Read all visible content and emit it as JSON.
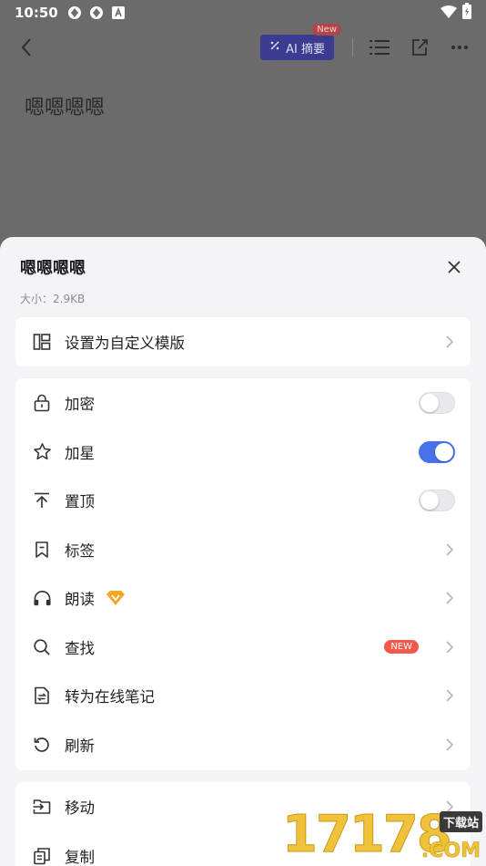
{
  "status_bar": {
    "time": "10:50"
  },
  "toolbar": {
    "ai_label": "AI 摘要",
    "ai_badge": "New"
  },
  "document": {
    "title": "嗯嗯嗯嗯"
  },
  "sheet": {
    "title": "嗯嗯嗯嗯",
    "size_text": "大小：2.9KB",
    "template_item": "设置为自定义模版",
    "items": [
      {
        "label": "加密",
        "icon": "lock-icon",
        "trailing": "toggle",
        "toggle_on": false
      },
      {
        "label": "加星",
        "icon": "star-icon",
        "trailing": "toggle",
        "toggle_on": true
      },
      {
        "label": "置顶",
        "icon": "pin-top-icon",
        "trailing": "toggle",
        "toggle_on": false
      },
      {
        "label": "标签",
        "icon": "bookmark-icon",
        "trailing": "chevron"
      },
      {
        "label": "朗读",
        "icon": "headphones-icon",
        "trailing": "chevron",
        "vip": true
      },
      {
        "label": "查找",
        "icon": "search-icon",
        "trailing": "chevron",
        "badge": "NEW"
      },
      {
        "label": "转为在线笔记",
        "icon": "convert-note-icon",
        "trailing": "chevron"
      },
      {
        "label": "刷新",
        "icon": "refresh-icon",
        "trailing": "chevron"
      }
    ],
    "more_items": [
      {
        "label": "移动",
        "icon": "move-icon"
      },
      {
        "label": "复制",
        "icon": "copy-icon"
      }
    ]
  },
  "watermark": {
    "digits": "17178",
    "label": "下载站",
    "domain": ".COM"
  },
  "colors": {
    "accent": "#4a72e8",
    "badge": "#f15a4a",
    "vip": "#f5a623"
  }
}
